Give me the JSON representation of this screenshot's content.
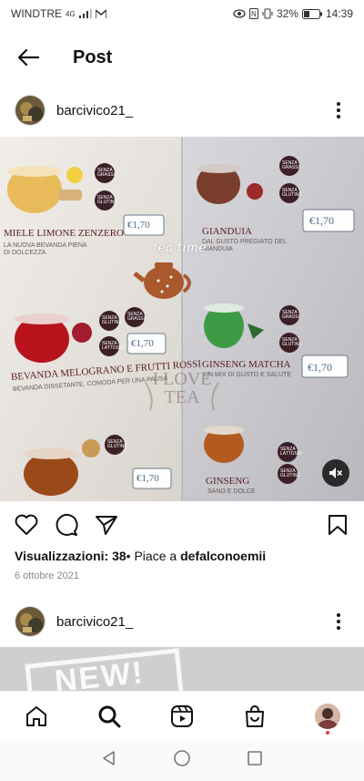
{
  "status_bar": {
    "carrier": "WINDTRE",
    "network": "4G",
    "battery": "32%",
    "time": "14:39"
  },
  "header": {
    "title": "Post"
  },
  "post": {
    "username": "barcivico21_",
    "actions": {
      "views_label": "Visualizzazioni: 38",
      "likes_prefix": "• Piace a ",
      "liked_by": "defalconoemii"
    },
    "date": "6 ottobre 2021",
    "media": {
      "items": [
        {
          "name": "MIELE LIMONE ZENZERO",
          "desc": "LA NUOVA BEVANDA PIENA DI DOLCEZZA",
          "price": "€1,70"
        },
        {
          "name": "GIANDUIA",
          "desc": "DAL GUSTO PREGIATO DEL GIANDUIA",
          "price": "€1,70"
        },
        {
          "name": "BEVANDA MELOGRANO E FRUTTI ROSSI",
          "desc": "BEVANDA DISSETANTE, COMODA PER UNA PAUSA",
          "price": "€1,70"
        },
        {
          "name": "GINSENG MATCHA",
          "desc": "UN MIX DI GUSTO E SALUTE",
          "price": "€1,70"
        },
        {
          "name": "GINSENG",
          "desc": "SANO E DOLCE",
          "price": "€1,70"
        }
      ],
      "script_text": "tea time",
      "love_text": "I LOVE TEA",
      "badge_top": "SENZA",
      "badge_gluten": "GLUTINE",
      "badge_fat": "GRASSI",
      "badge_lactose": "LATTOSIO"
    }
  },
  "post2": {
    "username": "barcivico21_",
    "media_text": "NEW!"
  },
  "icons": {
    "back": "arrow-left-icon",
    "more": "more-vertical-icon",
    "like": "heart-icon",
    "comment": "comment-icon",
    "share": "send-icon",
    "save": "bookmark-icon",
    "mute": "volume-off-icon",
    "nav": [
      "home-icon",
      "search-icon",
      "reels-icon",
      "shop-icon",
      "profile-avatar"
    ]
  }
}
